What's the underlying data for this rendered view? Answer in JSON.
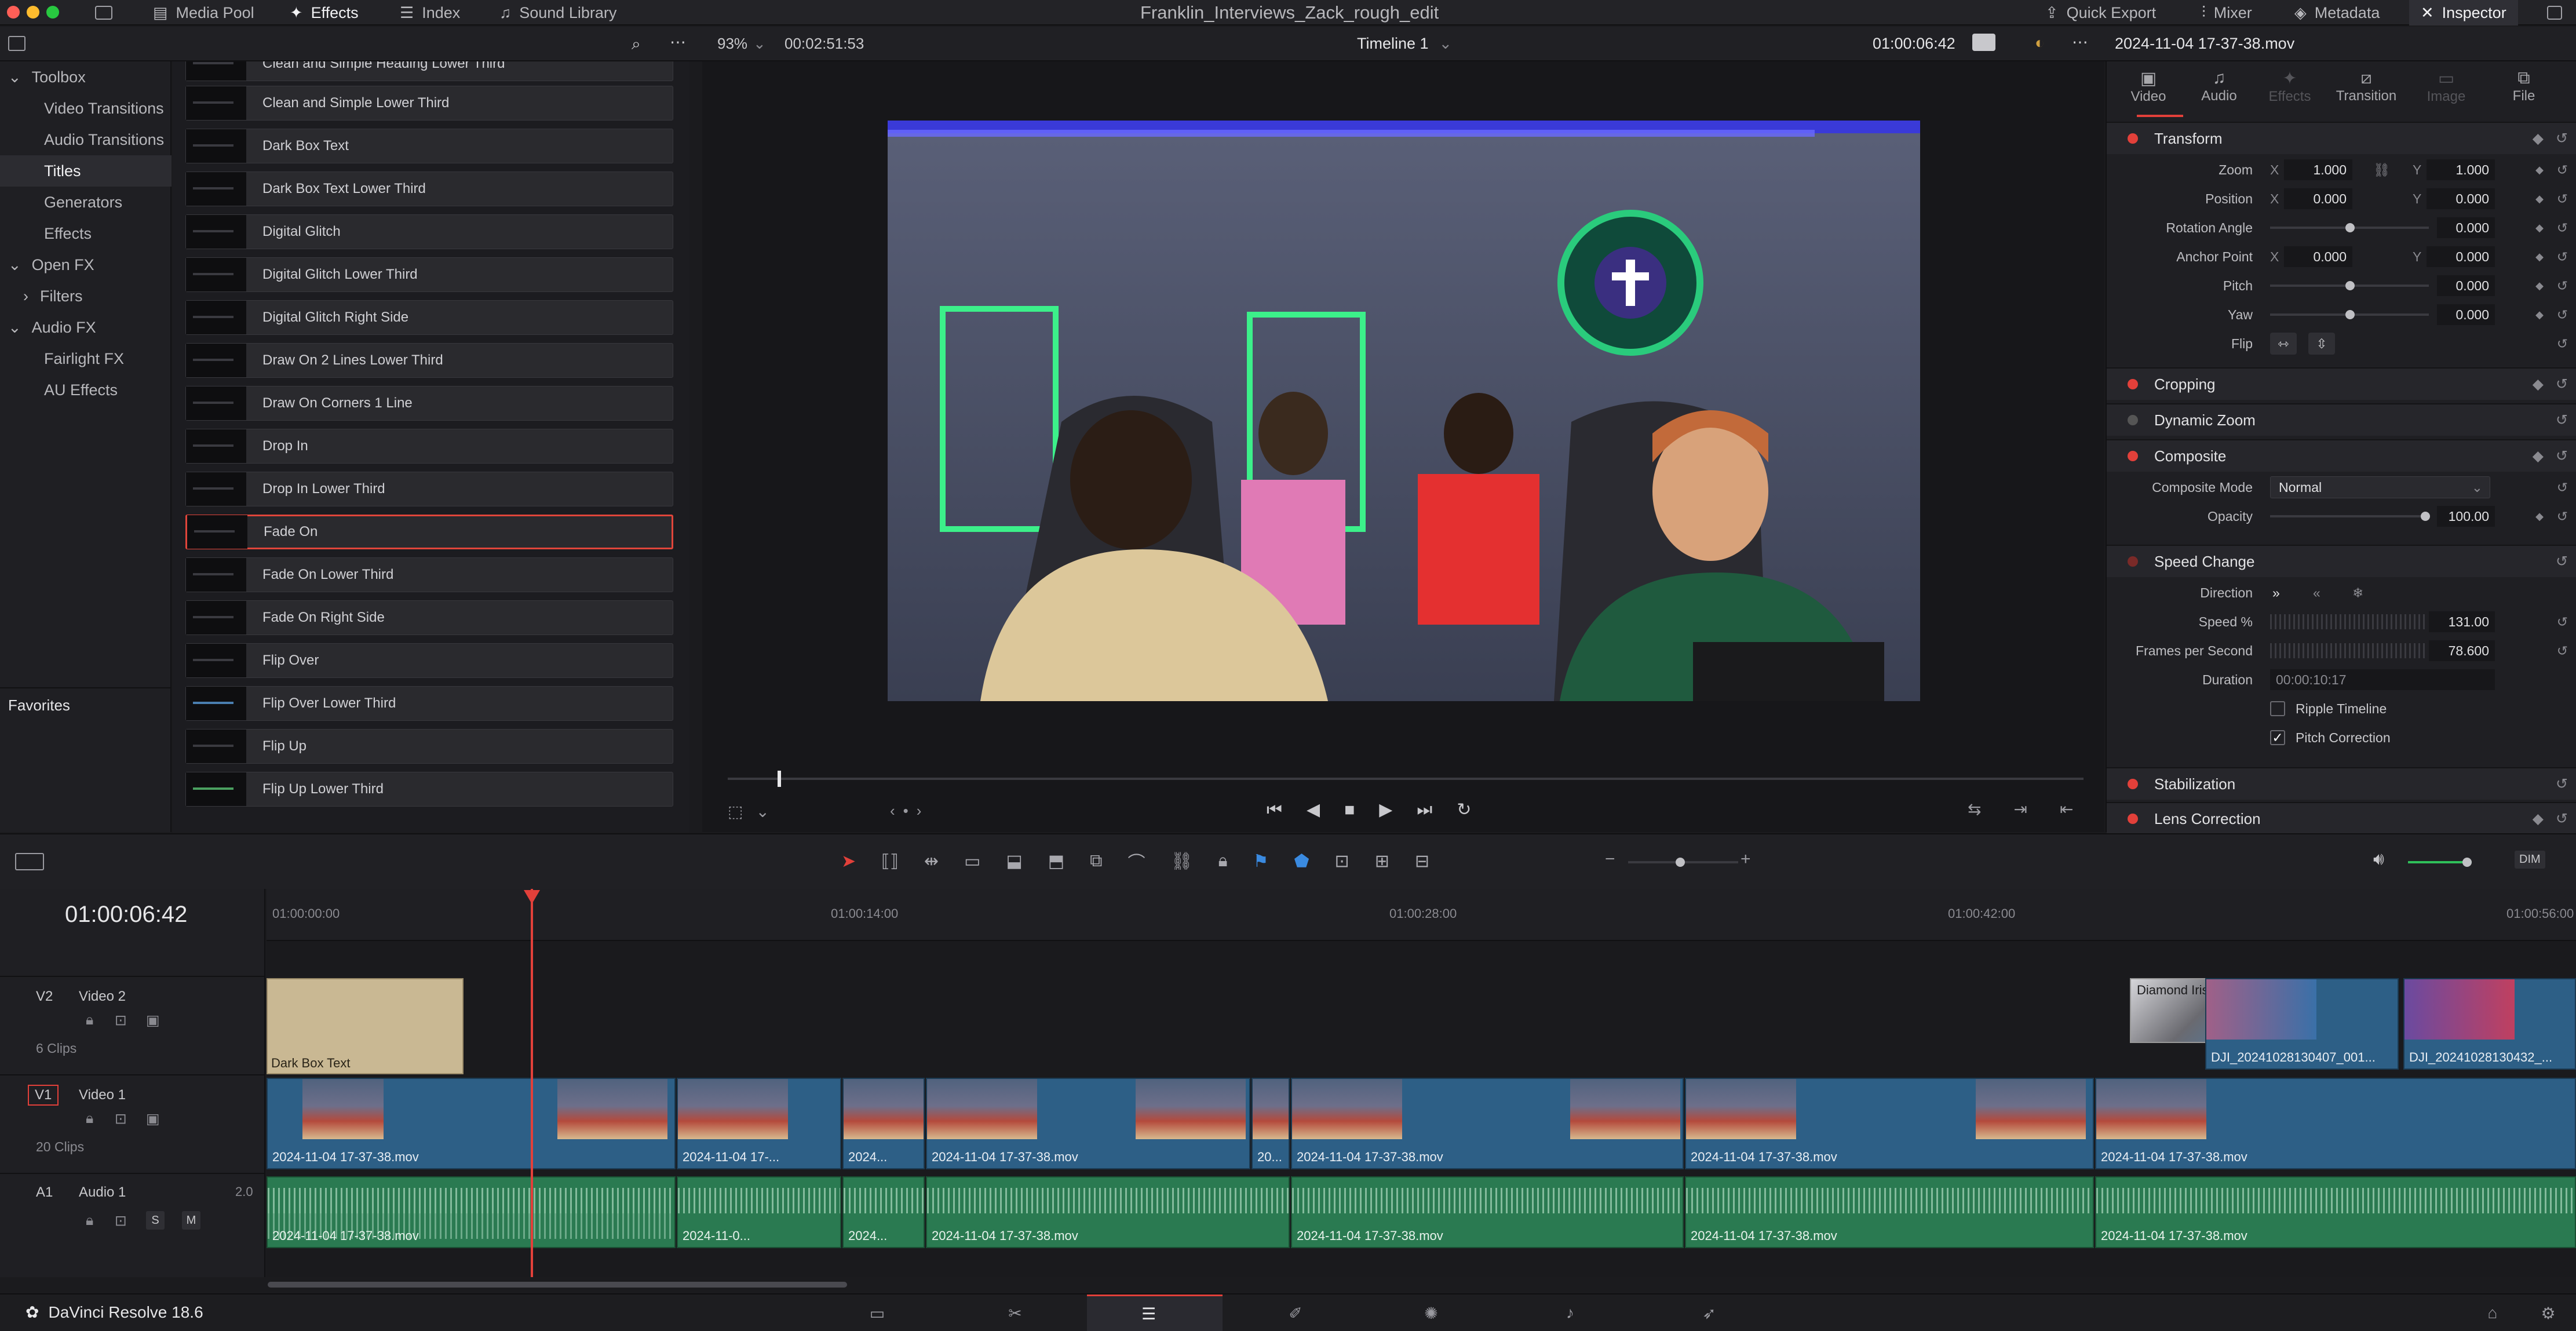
{
  "topbar": {
    "media_pool": "Media Pool",
    "effects": "Effects",
    "index": "Index",
    "sound_library": "Sound Library",
    "project_title": "Franklin_Interviews_Zack_rough_edit",
    "quick_export": "Quick Export",
    "mixer": "Mixer",
    "metadata": "Metadata",
    "inspector": "Inspector"
  },
  "subbar": {
    "zoom": "93%",
    "source_timecode": "00:02:51:53",
    "timeline_name": "Timeline 1",
    "record_timecode": "01:00:06:42",
    "clip_name": "2024-11-04 17-37-38.mov"
  },
  "toolbox": {
    "items": [
      {
        "label": "Toolbox",
        "level": 0,
        "expanded": true
      },
      {
        "label": "Video Transitions",
        "level": 1
      },
      {
        "label": "Audio Transitions",
        "level": 1
      },
      {
        "label": "Titles",
        "level": 1,
        "selected": true
      },
      {
        "label": "Generators",
        "level": 1
      },
      {
        "label": "Effects",
        "level": 1
      },
      {
        "label": "Open FX",
        "level": 0,
        "expanded": true
      },
      {
        "label": "Filters",
        "level": 1,
        "collapsed": true
      },
      {
        "label": "Audio FX",
        "level": 0,
        "expanded": true
      },
      {
        "label": "Fairlight FX",
        "level": 1
      },
      {
        "label": "AU Effects",
        "level": 1
      }
    ],
    "favorites": "Favorites"
  },
  "titles": [
    "Clean and Simple Heading Lower Third",
    "Clean and Simple Lower Third",
    "Dark Box Text",
    "Dark Box Text Lower Third",
    "Digital Glitch",
    "Digital Glitch Lower Third",
    "Digital Glitch Right Side",
    "Draw On 2 Lines Lower Third",
    "Draw On Corners 1 Line",
    "Drop In",
    "Drop In Lower Third",
    "Fade On",
    "Fade On Lower Third",
    "Fade On Right Side",
    "Flip Over",
    "Flip Over Lower Third",
    "Flip Up",
    "Flip Up Lower Third"
  ],
  "selected_title": "Fade On",
  "inspector": {
    "tabs": [
      {
        "label": "Video",
        "active": true
      },
      {
        "label": "Audio"
      },
      {
        "label": "Effects",
        "disabled": true
      },
      {
        "label": "Transition"
      },
      {
        "label": "Image",
        "disabled": true
      },
      {
        "label": "File"
      }
    ],
    "transform": {
      "title": "Transform",
      "zoom_label": "Zoom",
      "zoom_x": "1.000",
      "zoom_y": "1.000",
      "position_label": "Position",
      "position_x": "0.000",
      "position_y": "0.000",
      "rotation_label": "Rotation Angle",
      "rotation": "0.000",
      "anchor_label": "Anchor Point",
      "anchor_x": "0.000",
      "anchor_y": "0.000",
      "pitch_label": "Pitch",
      "pitch": "0.000",
      "yaw_label": "Yaw",
      "yaw": "0.000",
      "flip_label": "Flip",
      "x": "X",
      "y": "Y"
    },
    "cropping": "Cropping",
    "dynamic_zoom": "Dynamic Zoom",
    "composite": {
      "title": "Composite",
      "mode_label": "Composite Mode",
      "mode": "Normal",
      "opacity_label": "Opacity",
      "opacity": "100.00"
    },
    "speed_change": {
      "title": "Speed Change",
      "direction_label": "Direction",
      "speed_label": "Speed %",
      "speed": "131.00",
      "fps_label": "Frames per Second",
      "fps": "78.600",
      "duration_label": "Duration",
      "duration": "00:00:10:17",
      "ripple": "Ripple Timeline",
      "ripple_checked": false,
      "pitch_correction": "Pitch Correction",
      "pitch_checked": true
    },
    "stabilization": "Stabilization",
    "lens_correction": "Lens Correction"
  },
  "timeline": {
    "timecode": "01:00:06:42",
    "ruler": [
      "01:00:00:00",
      "01:00:14:00",
      "01:00:28:00",
      "01:00:42:00",
      "01:00:56:00"
    ],
    "tracks": {
      "v2": {
        "id": "V2",
        "name": "Video 2",
        "clips": "6 Clips"
      },
      "v1": {
        "id": "V1",
        "name": "Video 1",
        "clips": "20 Clips"
      },
      "a1": {
        "id": "A1",
        "name": "Audio 1",
        "channels": "2.0"
      }
    },
    "v2_clips": [
      "Dark Box Text",
      "Diamond Iris",
      "DJI_20241028130407_001...",
      "DJI_20241028130432_..."
    ],
    "v1_clip_names": [
      "2024-11-04 17-37-38.mov",
      "2024-11-04 17-...",
      "2024...",
      "2024-11-04 17-37-38.mov",
      "20...",
      "2024-11-04 17-37-38.mov",
      "2024-11-04 17-37-38.mov",
      "2024-11-04 17-37-38.mov"
    ],
    "a1_clip_names": [
      "2024-11-04 17-37-38.mov",
      "2024-11-0...",
      "2024...",
      "2024-11-04 17-37-38.mov",
      "2024-11-04 17-37-38.mov",
      "2024-11-04 17-37-38.mov",
      "2024-11-04 17-37-38.mov"
    ],
    "dim_label": "DIM"
  },
  "app": {
    "name": "DaVinci Resolve 18.6"
  },
  "colors": {
    "accent_red": "#e2403a",
    "video_clip": "#2d5f86",
    "audio_clip": "#2a7a51",
    "title_clip": "#c9b893"
  }
}
